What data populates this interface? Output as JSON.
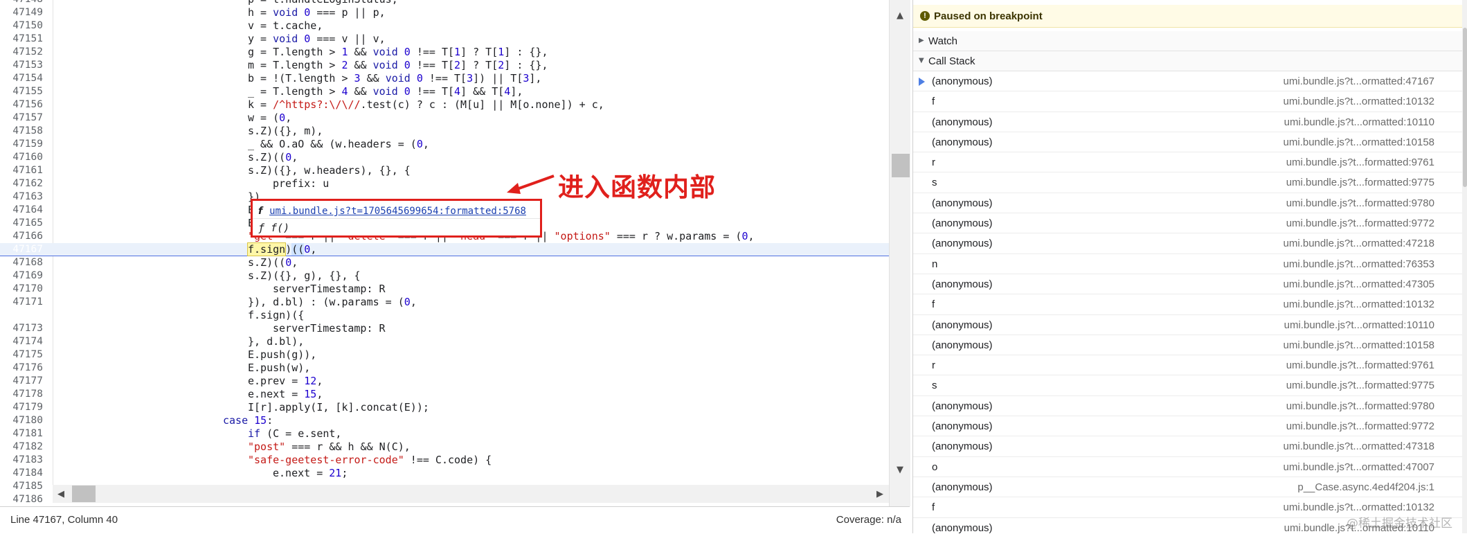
{
  "editor": {
    "lines": [
      {
        "n": "47148",
        "indent": 0,
        "parts": [
          [
            "id",
            "p = t.handleLoginStatus,"
          ]
        ]
      },
      {
        "n": "47149",
        "indent": 0,
        "parts": [
          [
            "id",
            "h = "
          ],
          [
            "kw",
            "void"
          ],
          [
            "id",
            " "
          ],
          [
            "num",
            "0"
          ],
          [
            "id",
            " === p || p,"
          ]
        ]
      },
      {
        "n": "47150",
        "indent": 0,
        "parts": [
          [
            "id",
            "v = t.cache,"
          ]
        ]
      },
      {
        "n": "47151",
        "indent": 0,
        "parts": [
          [
            "id",
            "y = "
          ],
          [
            "kw",
            "void"
          ],
          [
            "id",
            " "
          ],
          [
            "num",
            "0"
          ],
          [
            "id",
            " === v || v,"
          ]
        ]
      },
      {
        "n": "47152",
        "indent": 0,
        "parts": [
          [
            "id",
            "g = T.length > "
          ],
          [
            "num",
            "1"
          ],
          [
            "id",
            " && "
          ],
          [
            "kw",
            "void"
          ],
          [
            "id",
            " "
          ],
          [
            "num",
            "0"
          ],
          [
            "id",
            " !== T["
          ],
          [
            "num",
            "1"
          ],
          [
            "id",
            "] ? T["
          ],
          [
            "num",
            "1"
          ],
          [
            "id",
            "] : {},"
          ]
        ]
      },
      {
        "n": "47153",
        "indent": 0,
        "parts": [
          [
            "id",
            "m = T.length > "
          ],
          [
            "num",
            "2"
          ],
          [
            "id",
            " && "
          ],
          [
            "kw",
            "void"
          ],
          [
            "id",
            " "
          ],
          [
            "num",
            "0"
          ],
          [
            "id",
            " !== T["
          ],
          [
            "num",
            "2"
          ],
          [
            "id",
            "] ? T["
          ],
          [
            "num",
            "2"
          ],
          [
            "id",
            "] : {},"
          ]
        ]
      },
      {
        "n": "47154",
        "indent": 0,
        "parts": [
          [
            "id",
            "b = !(T.length > "
          ],
          [
            "num",
            "3"
          ],
          [
            "id",
            " && "
          ],
          [
            "kw",
            "void"
          ],
          [
            "id",
            " "
          ],
          [
            "num",
            "0"
          ],
          [
            "id",
            " !== T["
          ],
          [
            "num",
            "3"
          ],
          [
            "id",
            "]) || T["
          ],
          [
            "num",
            "3"
          ],
          [
            "id",
            "],"
          ]
        ]
      },
      {
        "n": "47155",
        "indent": 0,
        "parts": [
          [
            "id",
            "_ = T.length > "
          ],
          [
            "num",
            "4"
          ],
          [
            "id",
            " && "
          ],
          [
            "kw",
            "void"
          ],
          [
            "id",
            " "
          ],
          [
            "num",
            "0"
          ],
          [
            "id",
            " !== T["
          ],
          [
            "num",
            "4"
          ],
          [
            "id",
            "] && T["
          ],
          [
            "num",
            "4"
          ],
          [
            "id",
            "],"
          ]
        ]
      },
      {
        "n": "47156",
        "indent": 0,
        "parts": [
          [
            "id",
            "k = "
          ],
          [
            "str",
            "/^https?:\\/\\//"
          ],
          [
            "id",
            ".test(c) ? c : (M[u] || M[o.none]) + c,"
          ]
        ]
      },
      {
        "n": "47157",
        "indent": 0,
        "parts": [
          [
            "id",
            "w = ("
          ],
          [
            "num",
            "0"
          ],
          [
            "id",
            ","
          ]
        ]
      },
      {
        "n": "47158",
        "indent": 0,
        "parts": [
          [
            "id",
            "s.Z)({}, m),"
          ]
        ]
      },
      {
        "n": "47159",
        "indent": 0,
        "parts": [
          [
            "id",
            "_ && O.aO && (w.headers = ("
          ],
          [
            "num",
            "0"
          ],
          [
            "id",
            ","
          ]
        ]
      },
      {
        "n": "47160",
        "indent": 0,
        "parts": [
          [
            "id",
            "s.Z)(("
          ],
          [
            "num",
            "0"
          ],
          [
            "id",
            ","
          ]
        ]
      },
      {
        "n": "47161",
        "indent": 0,
        "parts": [
          [
            "id",
            "s.Z)({}, w.headers), {}, {"
          ]
        ]
      },
      {
        "n": "47162",
        "indent": 1,
        "parts": [
          [
            "id",
            "prefix: u"
          ]
        ]
      },
      {
        "n": "47163",
        "indent": 0,
        "parts": [
          [
            "id",
            "})"
          ]
        ]
      },
      {
        "n": "47164",
        "indent": 0,
        "parts": [
          [
            "id",
            "E"
          ]
        ]
      },
      {
        "n": "47165",
        "indent": 0,
        "parts": [
          [
            "id",
            "E"
          ]
        ]
      },
      {
        "n": "47166",
        "indent": 0,
        "parts": [
          [
            "str",
            "\"get\""
          ],
          [
            "id",
            " === r || "
          ],
          [
            "str",
            "\"delete\""
          ],
          [
            "id",
            " === r || "
          ],
          [
            "str",
            "\"head\""
          ],
          [
            "id",
            " === r || "
          ],
          [
            "str",
            "\"options\""
          ],
          [
            "id",
            " === r ? w.params = ("
          ],
          [
            "num",
            "0"
          ],
          [
            "id",
            ","
          ]
        ]
      },
      {
        "n": "47167",
        "indent": 0,
        "exec": true,
        "parts": [
          [
            "hlw",
            "f.sign"
          ],
          [
            "id",
            ")"
          ],
          [
            "hlp",
            "(("
          ],
          [
            "num",
            "0"
          ],
          [
            "id",
            ","
          ]
        ]
      },
      {
        "n": "47168",
        "indent": 0,
        "parts": [
          [
            "id",
            "s.Z)(("
          ],
          [
            "num",
            "0"
          ],
          [
            "id",
            ","
          ]
        ]
      },
      {
        "n": "47169",
        "indent": 0,
        "parts": [
          [
            "id",
            "s.Z)({}, g), {}, {"
          ]
        ]
      },
      {
        "n": "47170",
        "indent": 1,
        "parts": [
          [
            "id",
            "serverTimestamp: R"
          ]
        ]
      },
      {
        "n": "47171",
        "indent": 0,
        "parts": [
          [
            "id",
            "}), d.bl) : (w.params = ("
          ],
          [
            "num",
            "0"
          ],
          [
            "id",
            ","
          ]
        ]
      },
      {
        "n": "47172",
        "indent": 0,
        "bp": true,
        "parts": [
          [
            "id",
            "f.sign)({"
          ]
        ]
      },
      {
        "n": "47173",
        "indent": 1,
        "parts": [
          [
            "id",
            "serverTimestamp: R"
          ]
        ]
      },
      {
        "n": "47174",
        "indent": 0,
        "parts": [
          [
            "id",
            "}, d.bl),"
          ]
        ]
      },
      {
        "n": "47175",
        "indent": 0,
        "parts": [
          [
            "id",
            "E.push(g)),"
          ]
        ]
      },
      {
        "n": "47176",
        "indent": 0,
        "parts": [
          [
            "id",
            "E.push(w),"
          ]
        ]
      },
      {
        "n": "47177",
        "indent": 0,
        "parts": [
          [
            "id",
            "e.prev = "
          ],
          [
            "num",
            "12"
          ],
          [
            "id",
            ","
          ]
        ]
      },
      {
        "n": "47178",
        "indent": 0,
        "parts": [
          [
            "id",
            "e.next = "
          ],
          [
            "num",
            "15"
          ],
          [
            "id",
            ","
          ]
        ]
      },
      {
        "n": "47179",
        "indent": 0,
        "parts": [
          [
            "id",
            "I[r].apply(I, [k].concat(E));"
          ]
        ]
      },
      {
        "n": "47180",
        "indent": -1,
        "parts": [
          [
            "kw",
            "case"
          ],
          [
            "id",
            " "
          ],
          [
            "num",
            "15"
          ],
          [
            "id",
            ":"
          ]
        ]
      },
      {
        "n": "47181",
        "indent": 0,
        "parts": [
          [
            "kw",
            "if"
          ],
          [
            "id",
            " (C = e.sent,"
          ]
        ]
      },
      {
        "n": "47182",
        "indent": 0,
        "parts": [
          [
            "str",
            "\"post\""
          ],
          [
            "id",
            " === r && h && N(C),"
          ]
        ]
      },
      {
        "n": "47183",
        "indent": 0,
        "parts": [
          [
            "str",
            "\"safe-geetest-error-code\""
          ],
          [
            "id",
            " !== C.code) {"
          ]
        ]
      },
      {
        "n": "47184",
        "indent": 1,
        "parts": [
          [
            "id",
            "e.next = "
          ],
          [
            "num",
            "21"
          ],
          [
            "id",
            ";"
          ]
        ]
      },
      {
        "n": "47185",
        "indent": 0,
        "parts": [
          [
            "id",
            ""
          ]
        ]
      },
      {
        "n": "47186",
        "indent": 0,
        "parts": [
          [
            "id",
            ""
          ]
        ]
      }
    ]
  },
  "popover": {
    "kind": "f",
    "link": "umi.bundle.js?t=1705645699654:formatted:5768",
    "signature": "ƒ f()"
  },
  "annotation": {
    "text": "进入函数内部"
  },
  "status": {
    "position": "Line 47167, Column 40",
    "coverage": "Coverage: n/a"
  },
  "debugger": {
    "paused_text": "Paused on breakpoint",
    "info_icon": "!",
    "watch_label": "Watch",
    "callstack_label": "Call Stack",
    "frames": [
      {
        "name": "(anonymous)",
        "loc": "umi.bundle.js?t...ormatted:47167",
        "current": true
      },
      {
        "name": "f",
        "loc": "umi.bundle.js?t...ormatted:10132"
      },
      {
        "name": "(anonymous)",
        "loc": "umi.bundle.js?t...ormatted:10110"
      },
      {
        "name": "(anonymous)",
        "loc": "umi.bundle.js?t...ormatted:10158"
      },
      {
        "name": "r",
        "loc": "umi.bundle.js?t...formatted:9761"
      },
      {
        "name": "s",
        "loc": "umi.bundle.js?t...formatted:9775"
      },
      {
        "name": "(anonymous)",
        "loc": "umi.bundle.js?t...formatted:9780"
      },
      {
        "name": "(anonymous)",
        "loc": "umi.bundle.js?t...formatted:9772"
      },
      {
        "name": "(anonymous)",
        "loc": "umi.bundle.js?t...ormatted:47218"
      },
      {
        "name": "n",
        "loc": "umi.bundle.js?t...ormatted:76353"
      },
      {
        "name": "(anonymous)",
        "loc": "umi.bundle.js?t...ormatted:47305"
      },
      {
        "name": "f",
        "loc": "umi.bundle.js?t...ormatted:10132"
      },
      {
        "name": "(anonymous)",
        "loc": "umi.bundle.js?t...ormatted:10110"
      },
      {
        "name": "(anonymous)",
        "loc": "umi.bundle.js?t...ormatted:10158"
      },
      {
        "name": "r",
        "loc": "umi.bundle.js?t...formatted:9761"
      },
      {
        "name": "s",
        "loc": "umi.bundle.js?t...formatted:9775"
      },
      {
        "name": "(anonymous)",
        "loc": "umi.bundle.js?t...formatted:9780"
      },
      {
        "name": "(anonymous)",
        "loc": "umi.bundle.js?t...formatted:9772"
      },
      {
        "name": "(anonymous)",
        "loc": "umi.bundle.js?t...ormatted:47318"
      },
      {
        "name": "o",
        "loc": "umi.bundle.js?t...ormatted:47007"
      },
      {
        "name": "(anonymous)",
        "loc": "p__Case.async.4ed4f204.js:1"
      },
      {
        "name": "f",
        "loc": "umi.bundle.js?t...ormatted:10132"
      },
      {
        "name": "(anonymous)",
        "loc": "umi.bundle.js?t...ormatted:10110"
      }
    ]
  },
  "watermark": "@稀土掘金技术社区",
  "colors": {
    "breakpoint": "#4e7fe4",
    "annotation_red": "#e0201c",
    "paused_bg": "#fffbe6"
  },
  "icons": [
    "scroll-up-icon",
    "scroll-down-icon",
    "scroll-left-icon",
    "scroll-right-icon",
    "info-icon",
    "expand-triangle-icon",
    "current-frame-pointer-icon",
    "annotation-arrow-icon"
  ]
}
